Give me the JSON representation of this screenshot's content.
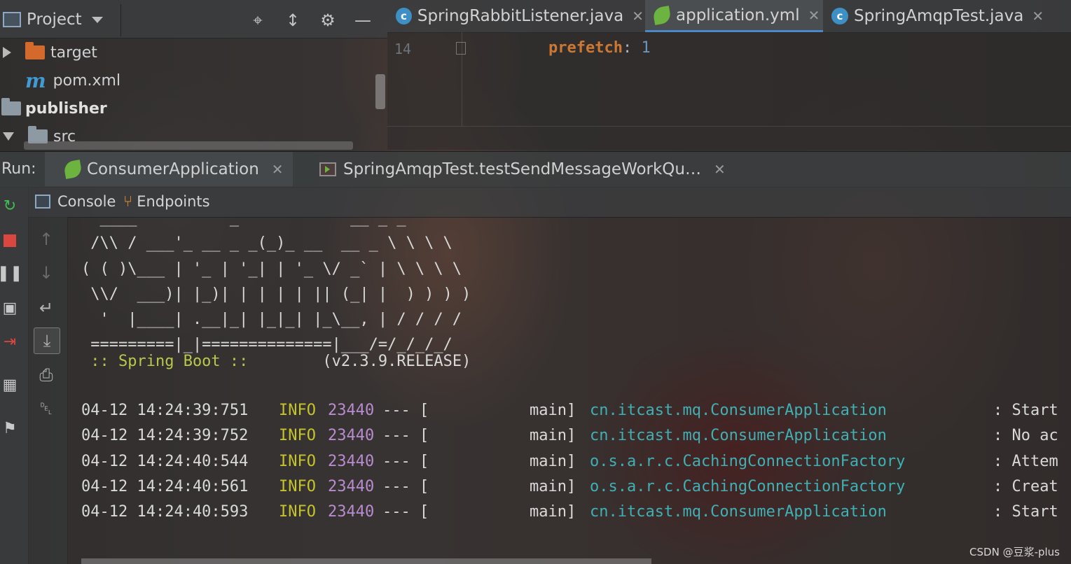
{
  "project_panel": {
    "title": "Project",
    "tree": [
      {
        "label": "target",
        "type": "folder"
      },
      {
        "label": "pom.xml",
        "type": "maven"
      },
      {
        "label": "publisher",
        "type": "module"
      },
      {
        "label": "src",
        "type": "folder"
      }
    ]
  },
  "editor_tabs": [
    {
      "label": "SpringRabbitListener.java",
      "icon": "java-class-icon"
    },
    {
      "label": "application.yml",
      "icon": "spring-yml-icon",
      "active": true
    },
    {
      "label": "SpringAmqpTest.java",
      "icon": "java-class-icon"
    }
  ],
  "editor": {
    "line_number": "14",
    "code_key": "prefetch",
    "code_colon": ":",
    "code_value": "1"
  },
  "run": {
    "label": "Run:",
    "tabs": [
      {
        "label": "ConsumerApplication",
        "active": true
      },
      {
        "label": "SpringAmqpTest.testSendMessageWorkQu…"
      }
    ]
  },
  "sub_tabs": {
    "console": "Console",
    "endpoints": "Endpoints"
  },
  "console": {
    "banner_lines": [
      "  ____          _            __ _ _",
      " /\\\\ / ___'_ __ _ _(_)_ __  __ _ \\ \\ \\ \\",
      "( ( )\\___ | '_ | '_| | '_ \\/ _` | \\ \\ \\ \\",
      " \\\\/  ___)| |_)| | | | | || (_| |  ) ) ) )",
      "  '  |____| .__|_| |_|_| |_\\__, | / / / /",
      " =========|_|==============|___/=/_/_/_/"
    ],
    "boot_label": " :: Spring Boot :: ",
    "boot_version": "       (v2.3.9.RELEASE)",
    "logs": [
      {
        "time": "04-12 14:24:39:751",
        "level": "INFO",
        "pid": "23440",
        "sep": "--- [",
        "thread": "main]",
        "class": "cn.itcast.mq.ConsumerApplication",
        "msg": ": Start"
      },
      {
        "time": "04-12 14:24:39:752",
        "level": "INFO",
        "pid": "23440",
        "sep": "--- [",
        "thread": "main]",
        "class": "cn.itcast.mq.ConsumerApplication",
        "msg": ": No ac"
      },
      {
        "time": "04-12 14:24:40:544",
        "level": "INFO",
        "pid": "23440",
        "sep": "--- [",
        "thread": "main]",
        "class": "o.s.a.r.c.CachingConnectionFactory",
        "msg": ": Attem"
      },
      {
        "time": "04-12 14:24:40:561",
        "level": "INFO",
        "pid": "23440",
        "sep": "--- [",
        "thread": "main]",
        "class": "o.s.a.r.c.CachingConnectionFactory",
        "msg": ": Creat"
      },
      {
        "time": "04-12 14:24:40:593",
        "level": "INFO",
        "pid": "23440",
        "sep": "--- [",
        "thread": "main]",
        "class": "cn.itcast.mq.ConsumerApplication",
        "msg": ": Start"
      }
    ]
  },
  "watermark": "CSDN @豆浆-plus"
}
